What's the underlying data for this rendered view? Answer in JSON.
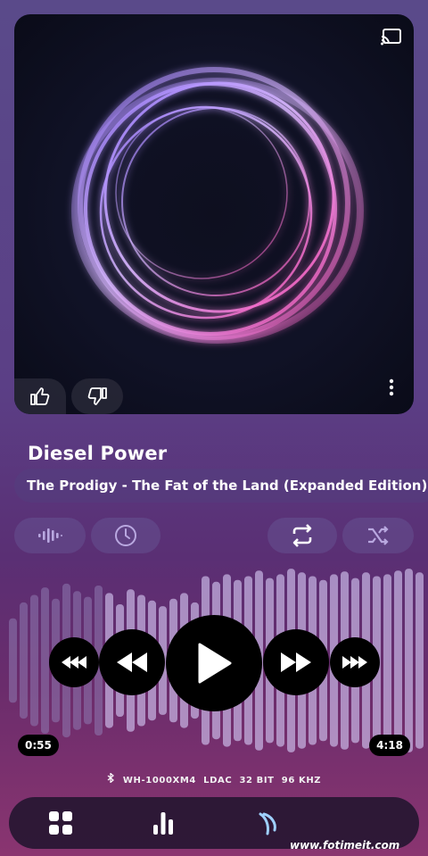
{
  "track": {
    "title": "Diesel Power",
    "subtitle": "The Prodigy - The Fat of the Land (Expanded Edition)"
  },
  "artwork": {
    "icons": [
      "cast-icon",
      "thumbs-up-icon",
      "thumbs-down-icon",
      "more-vert-icon"
    ]
  },
  "controls": {
    "icons": [
      "equalizer-icon",
      "timer-icon",
      "repeat-icon",
      "shuffle-icon"
    ]
  },
  "playback": {
    "elapsed": "0:55",
    "duration": "4:18",
    "progress": 0.213,
    "icons": [
      "fast-rewind-icon",
      "rewind-icon",
      "play-icon",
      "fast-forward-icon",
      "skip-forward-icon"
    ]
  },
  "output": {
    "device": "WH-1000XM4",
    "codec": "LDAC",
    "bit_depth": "32 BIT",
    "sample_rate": "96 KHZ"
  },
  "bottom_nav": {
    "icons": [
      "grid-icon",
      "bar-chart-icon",
      "lyrics-icon"
    ]
  },
  "watermark": {
    "text": "www.fotimeit.com"
  },
  "colors": {
    "accent_purple": "#8a5cf5",
    "accent_pink": "#e04fb0",
    "wave_played": "#c9b8e6",
    "wave_unplayed": "#8e7ab0"
  }
}
